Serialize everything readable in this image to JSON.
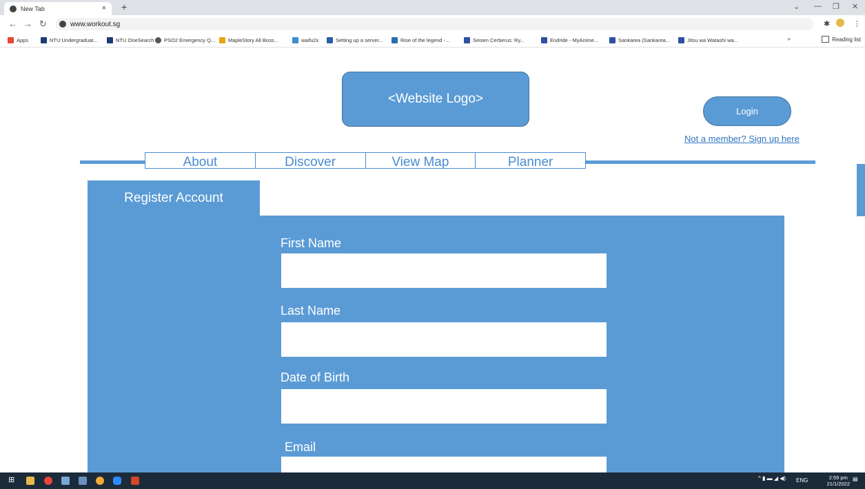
{
  "browser": {
    "tab_title": "New Tab",
    "tab_close": "×",
    "new_tab": "+",
    "url": "www.workout.sg",
    "bookmarks": [
      {
        "label": "Apps",
        "color": "#e8453c"
      },
      {
        "label": "NTU:Undergraduat...",
        "color": "#1d3b74"
      },
      {
        "label": "NTU OneSearch",
        "color": "#1d3b74"
      },
      {
        "label": "PSO2 Emergency Q...",
        "color": "#555555"
      },
      {
        "label": "MapleStory All Boss...",
        "color": "#e8a317"
      },
      {
        "label": "waifu2x",
        "color": "#3b8ed0"
      },
      {
        "label": "Setting up a server...",
        "color": "#2b5fa6"
      },
      {
        "label": "Rise of the legend -...",
        "color": "#2a6fb0"
      },
      {
        "label": "Seisen Cerberus: Ry...",
        "color": "#2e51a2"
      },
      {
        "label": "Endride - MyAnime...",
        "color": "#2e51a2"
      },
      {
        "label": "Sankarea (Sankarea...",
        "color": "#2e51a2"
      },
      {
        "label": "Jitsu wa Watashi wa...",
        "color": "#2e51a2"
      }
    ],
    "bookmarks_more": "»",
    "reading_list": "Reading list"
  },
  "page": {
    "logo_text": "<Website Logo>",
    "login_label": "Login",
    "signup_link": "Not a member? Sign up here",
    "nav": [
      "About",
      "Discover",
      "View Map",
      "Planner"
    ],
    "register_tab": "Register Account",
    "fields": {
      "first_name": "First Name",
      "last_name": "Last Name",
      "dob": "Date of Birth",
      "email": "Email"
    }
  },
  "taskbar": {
    "lang": "ENG",
    "time": "2:59 pm",
    "date": "21/1/2022"
  },
  "colors": {
    "accent": "#5b9bd5",
    "link": "#2f74c0",
    "taskbar": "#1c2b3a"
  }
}
